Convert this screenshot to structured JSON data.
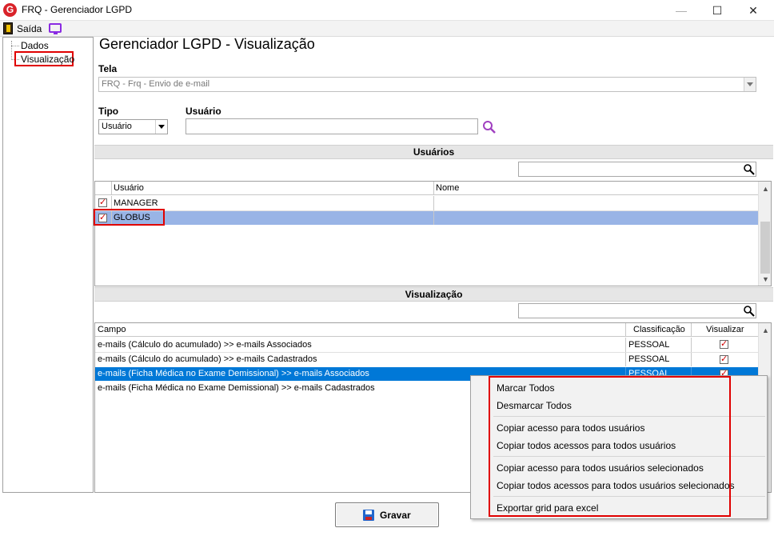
{
  "window": {
    "title": "FRQ - Gerenciador LGPD",
    "app_icon_letter": "G"
  },
  "toolbar": {
    "exit_label": "Saída"
  },
  "tree": {
    "items": [
      {
        "label": "Dados"
      },
      {
        "label": "Visualização"
      }
    ]
  },
  "page_title": "Gerenciador LGPD - Visualização",
  "tela": {
    "label": "Tela",
    "value": "FRQ - Frq - Envio de e-mail"
  },
  "tipo": {
    "label": "Tipo",
    "value": "Usuário"
  },
  "usuario": {
    "label": "Usuário",
    "value": ""
  },
  "usuarios_section": {
    "title": "Usuários",
    "columns": [
      "Usuário",
      "Nome"
    ],
    "rows": [
      {
        "usuario": "MANAGER",
        "nome": "",
        "checked": true
      },
      {
        "usuario": "GLOBUS",
        "nome": "",
        "checked": true
      }
    ]
  },
  "visualizacao_section": {
    "title": "Visualização",
    "columns": [
      "Campo",
      "Classificação",
      "Visualizar"
    ],
    "rows": [
      {
        "campo": "e-mails (Cálculo do acumulado) >> e-mails Associados",
        "classificacao": "PESSOAL",
        "visualizar": true
      },
      {
        "campo": "e-mails (Cálculo do acumulado) >> e-mails Cadastrados",
        "classificacao": "PESSOAL",
        "visualizar": true
      },
      {
        "campo": "e-mails (Ficha Médica no Exame Demissional) >> e-mails Associados",
        "classificacao": "PESSOAL",
        "visualizar": true
      },
      {
        "campo": "e-mails (Ficha Médica no Exame Demissional) >> e-mails Cadastrados",
        "classificacao": "",
        "visualizar": false
      }
    ]
  },
  "buttons": {
    "gravar": "Gravar"
  },
  "context_menu": {
    "items": [
      "Marcar Todos",
      "Desmarcar Todos",
      "Copiar acesso para todos usuários",
      "Copiar todos acessos para todos usuários",
      "Copiar acesso para todos usuários selecionados",
      "Copiar todos acessos para todos usuários selecionados",
      "Exportar grid para excel"
    ]
  },
  "colors": {
    "selection_blue": "#0078d7",
    "selection_light": "#99b4e6",
    "highlight_red": "#e00000"
  }
}
